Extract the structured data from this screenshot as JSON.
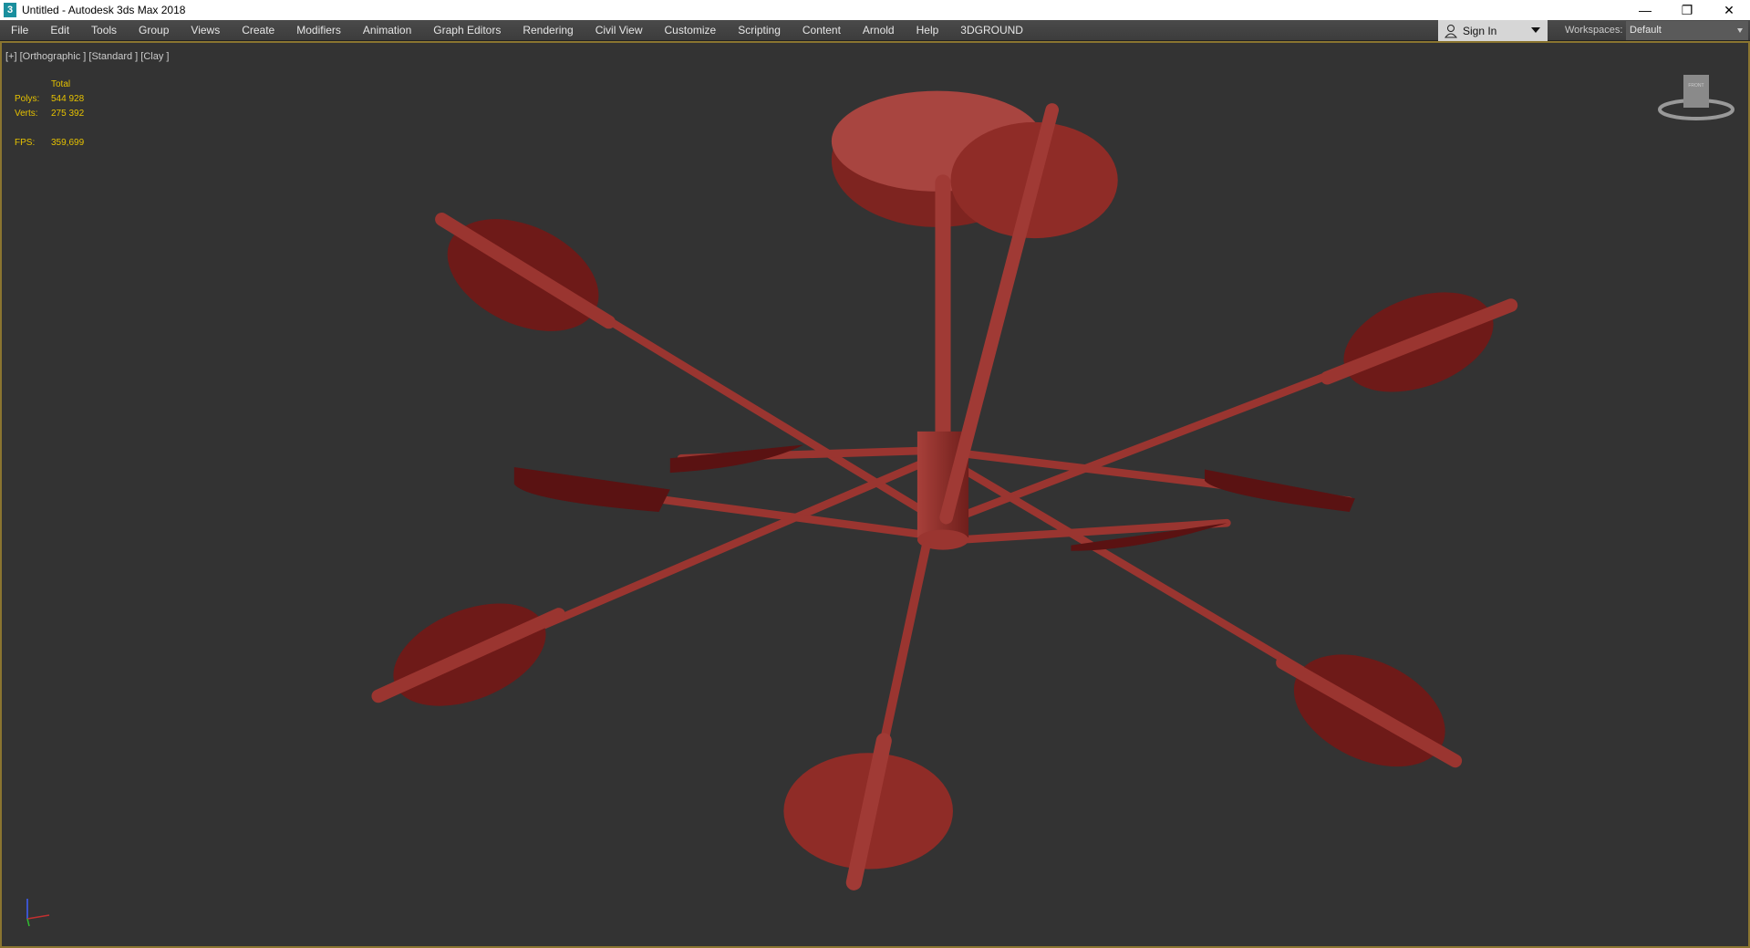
{
  "window": {
    "title": "Untitled - Autodesk 3ds Max 2018",
    "app_icon": "3",
    "controls": [
      "minimize",
      "restore",
      "close"
    ]
  },
  "menu": [
    "File",
    "Edit",
    "Tools",
    "Group",
    "Views",
    "Create",
    "Modifiers",
    "Animation",
    "Graph Editors",
    "Rendering",
    "Civil View",
    "Customize",
    "Scripting",
    "Content",
    "Arnold",
    "Help",
    "3DGROUND"
  ],
  "account": {
    "sign_in": "Sign In",
    "workspaces_label": "Workspaces:",
    "workspace": "Default"
  },
  "viewport": {
    "label": "[+] [Orthographic ] [Standard ] [Clay ]",
    "stats": {
      "header": "Total",
      "polys_label": "Polys:",
      "polys": "544 928",
      "verts_label": "Verts:",
      "verts": "275 392",
      "fps_label": "FPS:",
      "fps": "359,699"
    },
    "viewcube_face": "FRONT",
    "model_color": "#8b2a26"
  }
}
